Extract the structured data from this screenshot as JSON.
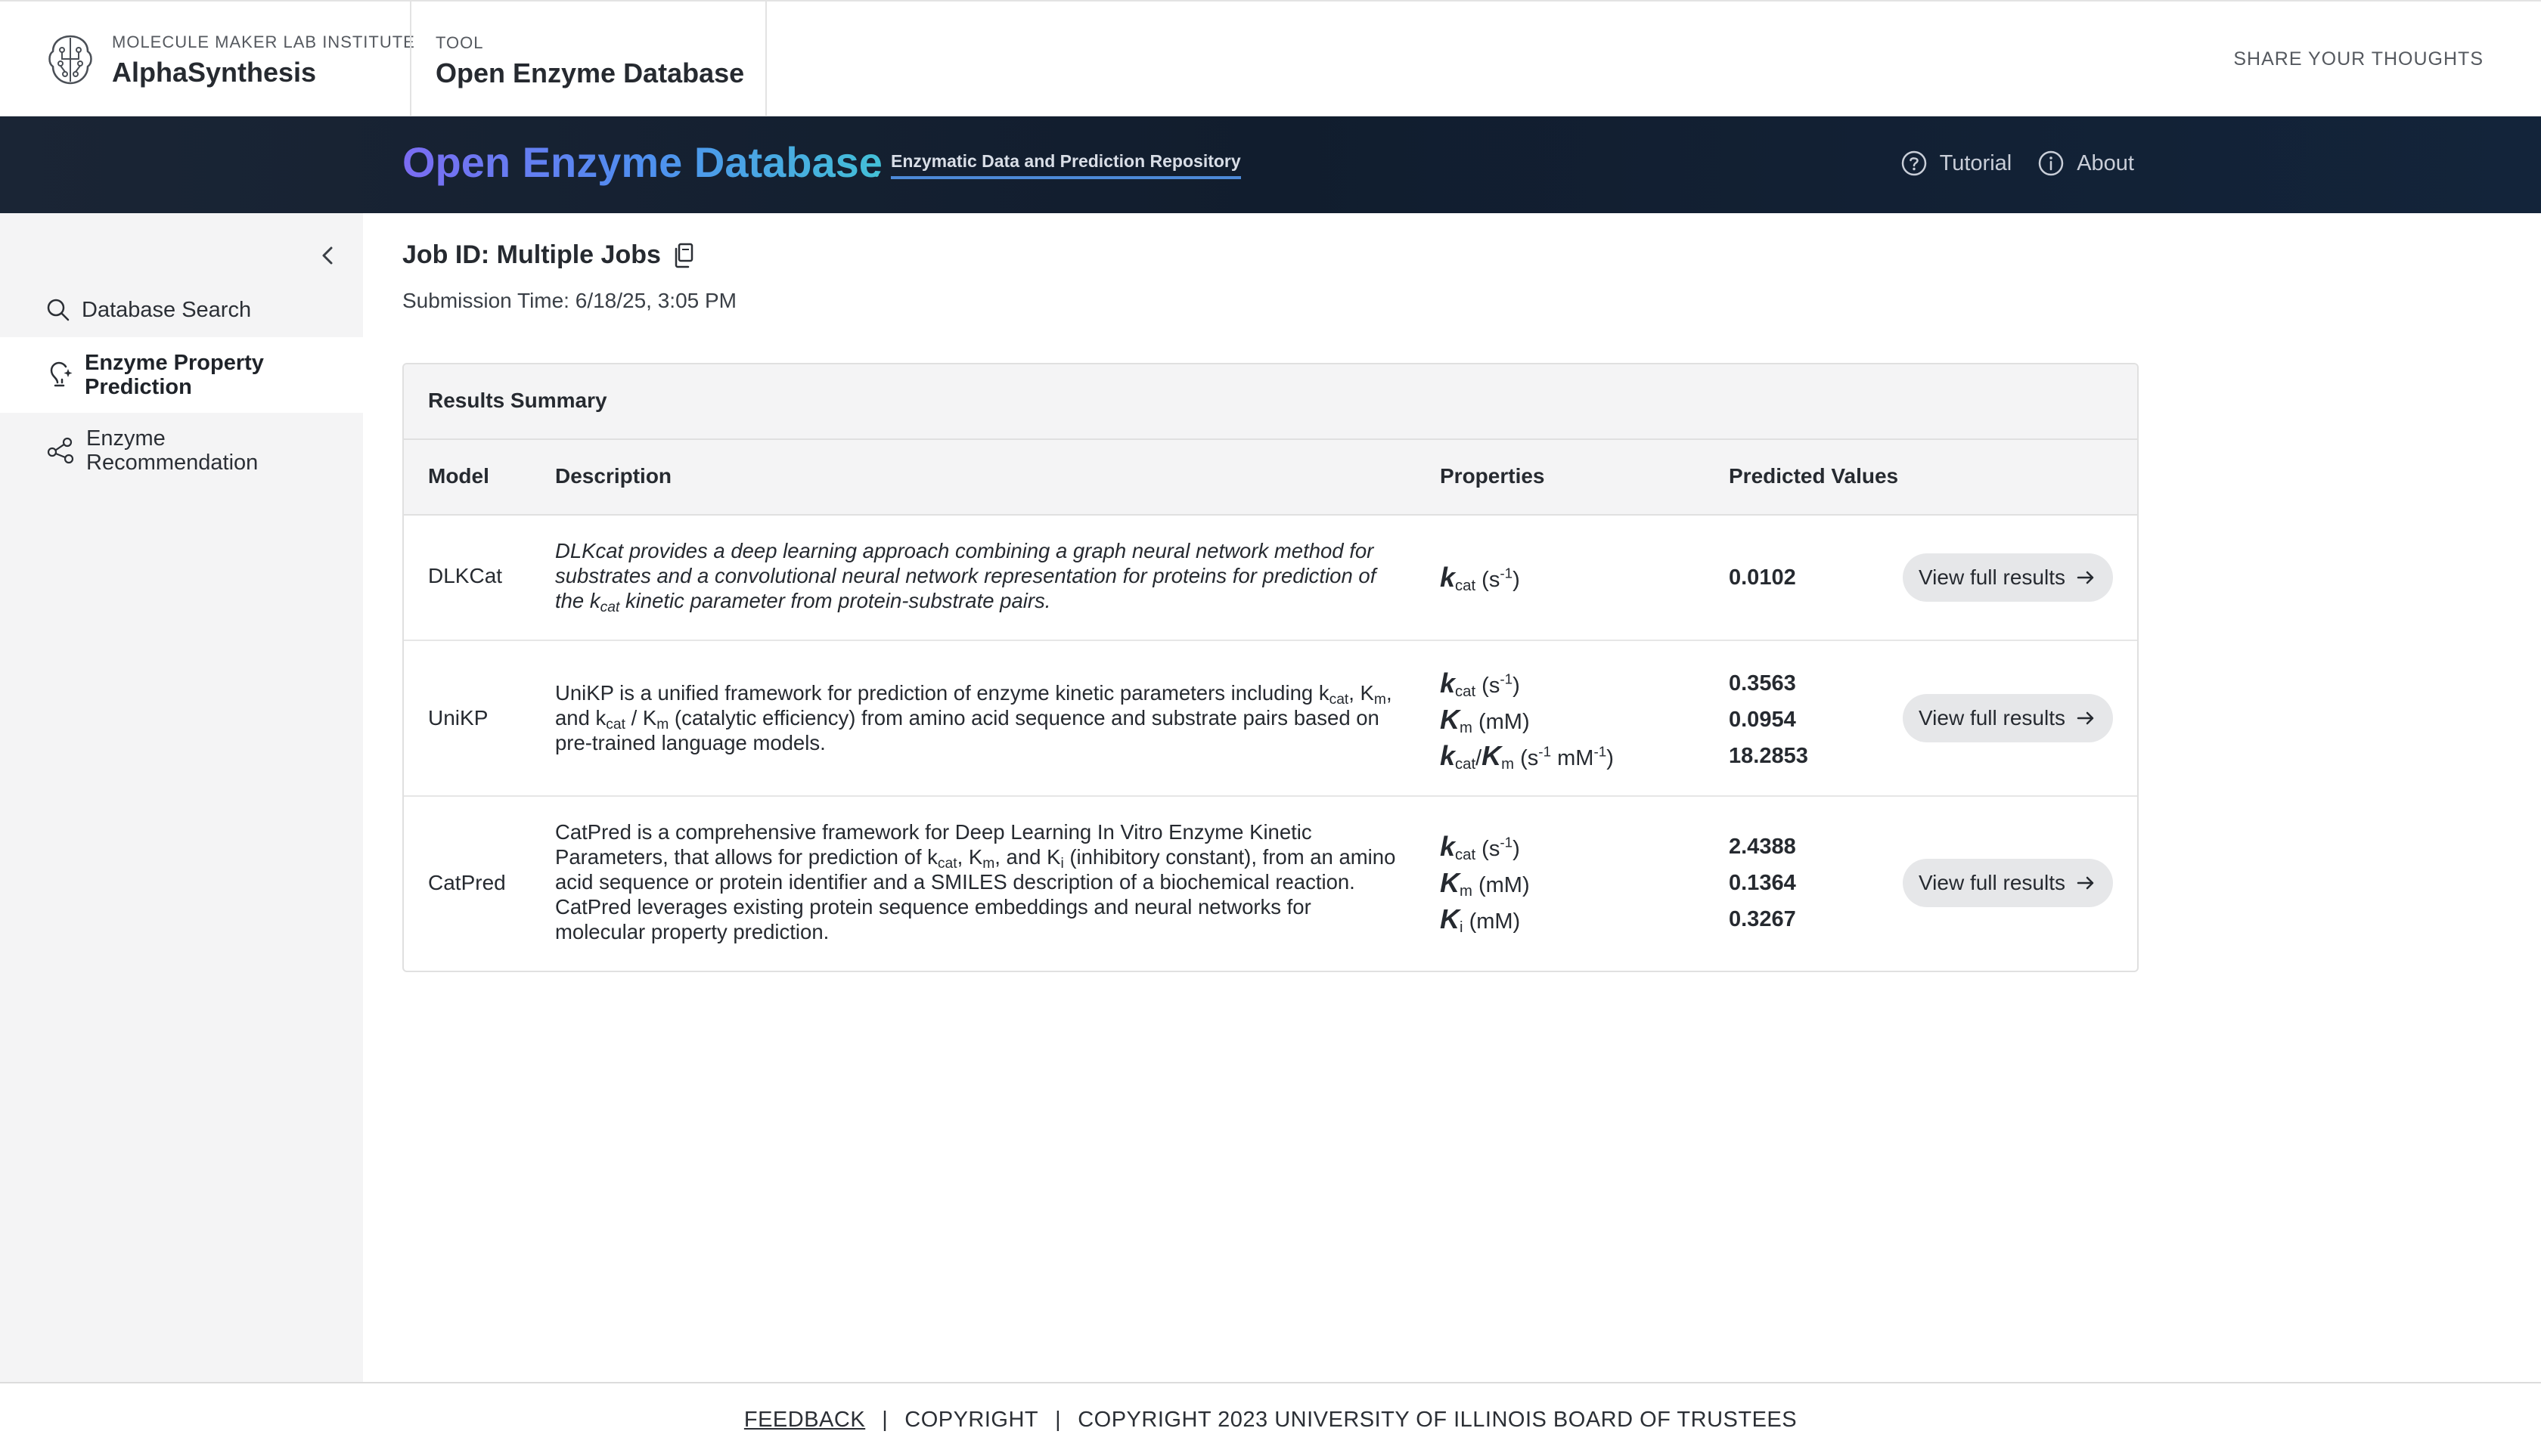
{
  "brand": {
    "kicker": "MOLECULE MAKER LAB INSTITUTE",
    "title": "AlphaSynthesis"
  },
  "tool": {
    "kicker": "TOOL",
    "title": "Open Enzyme Database"
  },
  "share_label": "SHARE YOUR THOUGHTS",
  "hero": {
    "title": "Open Enzyme Database",
    "subtitle": "Enzymatic Data and Prediction Repository",
    "nav": [
      {
        "label": "Tutorial",
        "icon": "help-circle-icon"
      },
      {
        "label": "About",
        "icon": "info-circle-icon"
      }
    ]
  },
  "sidebar": {
    "items": [
      {
        "label": "Database Search",
        "icon": "search-icon"
      },
      {
        "label": "Enzyme Property Prediction",
        "icon": "lightbulb-icon",
        "active": true
      },
      {
        "label": "Enzyme Recommendation",
        "icon": "share-nodes-icon"
      }
    ]
  },
  "job": {
    "title": "Job ID: Multiple Jobs",
    "submission": "Submission Time: 6/18/25, 3:05 PM"
  },
  "results": {
    "heading": "Results Summary",
    "columns": [
      "Model",
      "Description",
      "Properties",
      "Predicted Values"
    ],
    "button_label": "View full results",
    "rows": [
      {
        "model": "DLKCat",
        "description_parts": [
          "DLKcat provides a deep learning approach combining a graph neural network method for substrates and a convolutional neural network representation for proteins for prediction of the k",
          "cat",
          " kinetic parameter from protein-substrate pairs."
        ],
        "properties": [
          {
            "symbol": "k",
            "sub": "cat",
            "unit": "(s",
            "sup": "-1",
            "unit_end": ")"
          }
        ],
        "values": [
          "0.0102"
        ]
      },
      {
        "model": "UniKP",
        "description_parts": [
          "UniKP is a unified framework for prediction of enzyme kinetic parameters including k",
          "cat",
          ", K",
          "m",
          ", and k",
          "cat",
          " / K",
          "m",
          " (catalytic efficiency) from amino acid sequence and substrate pairs based on pre-trained language models."
        ],
        "properties": [
          {
            "symbol": "k",
            "sub": "cat",
            "unit": "(s",
            "sup": "-1",
            "unit_end": ")"
          },
          {
            "symbol": "K",
            "sub": "m",
            "unit": "(mM)"
          },
          {
            "symbol": "k",
            "sub": "cat",
            "slash": "/",
            "symbol2": "K",
            "sub2": "m",
            "unit": "(s",
            "sup": "-1",
            "unit_mid": " mM",
            "sup2": "-1",
            "unit_end": ")"
          }
        ],
        "values": [
          "0.3563",
          "0.0954",
          "18.2853"
        ]
      },
      {
        "model": "CatPred",
        "description_parts": [
          "CatPred is a comprehensive framework for Deep Learning In Vitro Enzyme Kinetic Parameters, that allows for prediction of k",
          "cat",
          ", K",
          "m",
          ", and K",
          "i",
          " (inhibitory constant), from an amino acid sequence or protein identifier and a SMILES description of a biochemical reaction. CatPred leverages existing protein sequence embeddings and neural networks for molecular property prediction."
        ],
        "properties": [
          {
            "symbol": "k",
            "sub": "cat",
            "unit": "(s",
            "sup": "-1",
            "unit_end": ")"
          },
          {
            "symbol": "K",
            "sub": "m",
            "unit": "(mM)"
          },
          {
            "symbol": "K",
            "sub": "i",
            "unit": "(mM)"
          }
        ],
        "values": [
          "2.4388",
          "0.1364",
          "0.3267"
        ]
      }
    ]
  },
  "footer": {
    "feedback": "FEEDBACK",
    "copyright": "COPYRIGHT",
    "copyright_full": "COPYRIGHT 2023 UNIVERSITY OF ILLINOIS BOARD OF TRUSTEES"
  }
}
